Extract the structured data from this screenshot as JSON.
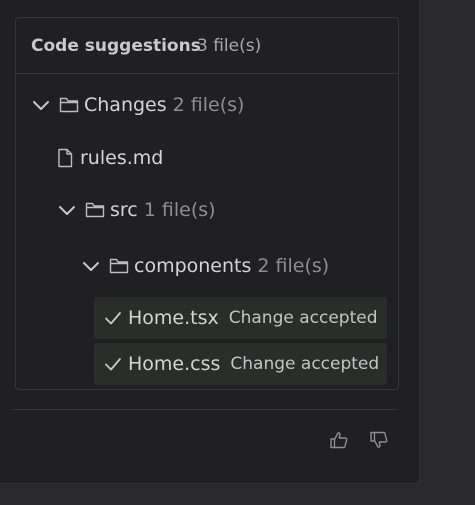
{
  "card": {
    "title": "Code suggestions",
    "count": "3 file(s)"
  },
  "tree": {
    "root": {
      "name": "Changes",
      "count": "2 file(s)"
    },
    "rules_file": {
      "name": "rules.md"
    },
    "src": {
      "name": "src",
      "count": "1 file(s)"
    },
    "components": {
      "name": "components",
      "count": "2 file(s)"
    },
    "accepted_files": [
      {
        "name": "Home.tsx",
        "status": "Change accepted"
      },
      {
        "name": "Home.css",
        "status": "Change accepted"
      }
    ]
  },
  "icons": {
    "chevron": "chevron-down-icon",
    "folder": "folder-icon",
    "file": "file-icon",
    "check": "check-icon",
    "thumbs_up": "thumbs-up-icon",
    "thumbs_down": "thumbs-down-icon"
  },
  "colors": {
    "panel_bg": "#202022",
    "page_bg": "#2a2a2d",
    "accepted_bg": "#2a2e2b",
    "text": "#d4d4d6",
    "muted": "#8e8e92"
  }
}
